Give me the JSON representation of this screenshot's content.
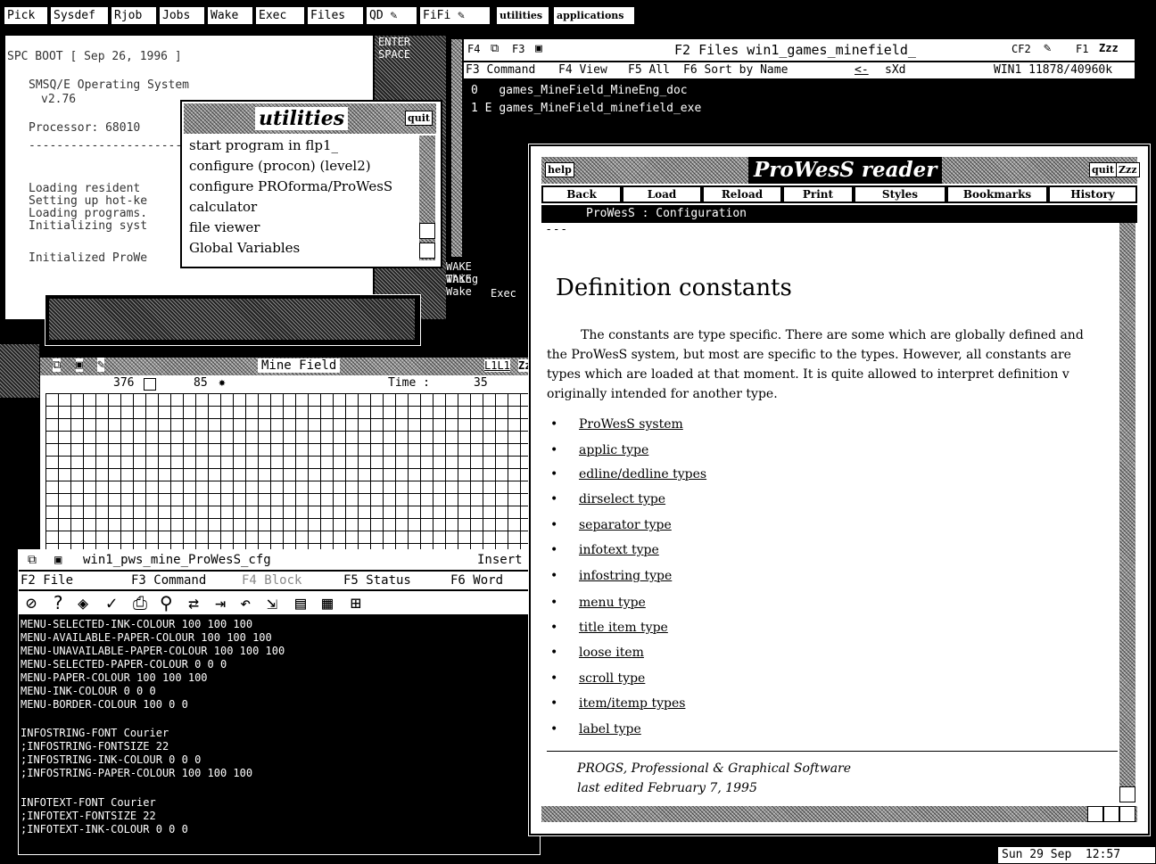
{
  "topbar": {
    "items": [
      "Pick",
      "Sysdef",
      "Rjob",
      "Jobs",
      "Wake",
      "Exec",
      "Files",
      "QD",
      "FiFi",
      "utilities",
      "applications"
    ]
  },
  "boot": {
    "line1": "SPC BOOT   [ Sep 26, 1996 ]",
    "line2": "SMSQ/E Operating System",
    "line3": "v2.76",
    "line4": "Processor: 68010",
    "line5": "-----------------------",
    "line6": "Loading resident",
    "line7": "Setting up hot-ke",
    "line8": "Loading programs.",
    "line9": "Initializing syst",
    "line10": "Initialized ProWe",
    "side_enter": "ENTER",
    "side_space": "SPACE",
    "side_wake1": "WAKE Thing",
    "side_wake2": "WAKE Wake",
    "side_exec": "Exec"
  },
  "utilities": {
    "title": "utilities",
    "quit": "quit",
    "items": [
      "start program in flp1_",
      "configure (procon) (level2)",
      "configure PROforma/ProWesS",
      "calculator",
      "file viewer",
      "Global Variables"
    ]
  },
  "files": {
    "header_left": "F4",
    "header_f3": "F3",
    "header_title": "F2 Files win1_games_minefield_",
    "header_right": "CF2",
    "header_f1": "F1",
    "header_zz": "Zzz",
    "cmd_f3": "F3 Command",
    "cmd_f4": "F4 View",
    "cmd_f5": "F5 All",
    "cmd_f6": "F6 Sort by Name",
    "cmd_arrow": "<-",
    "cmd_sxd": "sXd",
    "cmd_win": "WIN1 11878/40960k",
    "entry1_index": "0",
    "entry1_name": "games_MineField_MineEng_doc",
    "entry2_index": "1 E",
    "entry2_name": "games_MineField_minefield_exe"
  },
  "mine": {
    "title": "Mine Field",
    "count1": "376",
    "count2": "85",
    "time_label": "Time  :",
    "time_value": "35",
    "right_label": "L1L1",
    "right_zz": "Zz"
  },
  "editor": {
    "filename": "win1_pws_mine_ProWesS_cfg",
    "mode": "Insert",
    "menu_f2": "F2 File",
    "menu_f3": "F3 Command",
    "menu_f4": "F4 Block",
    "menu_f5": "F5 Status",
    "menu_f6": "F6 Word",
    "code_lines": [
      "MENU-SELECTED-INK-COLOUR 100 100 100",
      "MENU-AVAILABLE-PAPER-COLOUR 100 100 100",
      "MENU-UNAVAILABLE-PAPER-COLOUR 100 100 100",
      "MENU-SELECTED-PAPER-COLOUR 0 0 0",
      "MENU-PAPER-COLOUR 100 100 100",
      "MENU-INK-COLOUR 0 0 0",
      "MENU-BORDER-COLOUR 100 0 0",
      "",
      "INFOSTRING-FONT Courier",
      ";INFOSTRING-FONTSIZE 22",
      ";INFOSTRING-INK-COLOUR 0 0 0",
      ";INFOSTRING-PAPER-COLOUR 100 100 100",
      "",
      "INFOTEXT-FONT Courier",
      ";INFOTEXT-FONTSIZE 22",
      ";INFOTEXT-INK-COLOUR 0 0 0"
    ]
  },
  "reader": {
    "help": "help",
    "title": "ProWesS reader",
    "quit": "quit",
    "zz": "Zzz",
    "nav": [
      "Back",
      "Load",
      "Reload",
      "Print",
      "Styles",
      "Bookmarks",
      "History"
    ],
    "crumb": "ProWesS : Configuration",
    "dashes": "- - -",
    "heading": "Definition constants",
    "para": [
      "The constants are type specific. There are some which are globally defined and",
      "the ProWesS system, but most are specific to the types. However, all constants are",
      "types which are loaded at that moment. It is quite allowed to interpret definition v",
      "originally intended for another type."
    ],
    "links": [
      "ProWesS system",
      "applic type",
      "edline/dedline types",
      "dirselect type",
      "separator type",
      "infotext type",
      "infostring type",
      "menu type",
      "title item type",
      "loose item",
      "scroll type",
      "item/itemp types",
      "label type"
    ],
    "footer1": "PROGS, Professional & Graphical Software",
    "footer2": "last edited February 7, 1995"
  },
  "clock": {
    "text": "Sun 29 Sep  12:57"
  }
}
